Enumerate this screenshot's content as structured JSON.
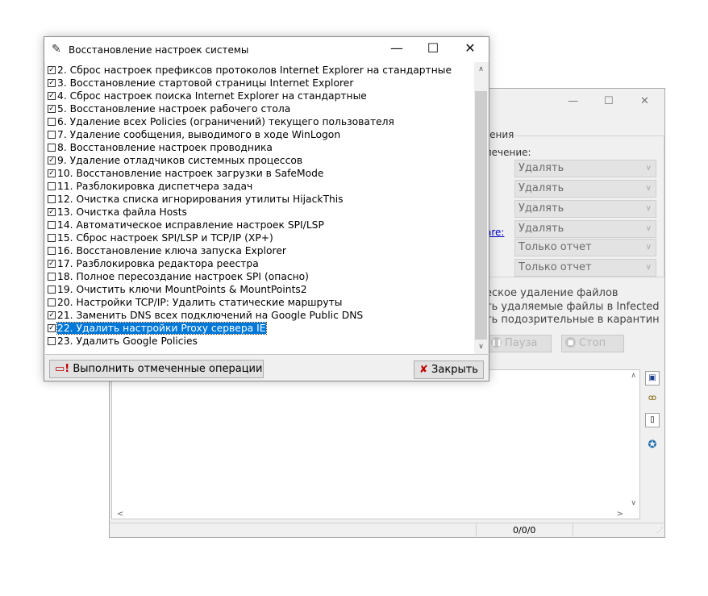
{
  "background_window": {
    "controls": {
      "minimize": "—",
      "maximize": "☐",
      "close": "✕"
    },
    "group_title": "чения",
    "treatment_label": "лечение:",
    "links": [
      "",
      ":",
      "are:"
    ],
    "dropdowns": [
      "Удалять",
      "Удалять",
      "Удалять",
      "Удалять",
      "Только отчет",
      "Только отчет"
    ],
    "options": [
      "еское удаление файлов",
      "ть удаляемые файлы в  Infected",
      "ть подозрительные в  карантин"
    ],
    "pause_button": "Пауза",
    "stop_button": "Стоп",
    "status_counter": "0/0/0"
  },
  "dialog": {
    "title": "Восстановление настроек системы",
    "controls": {
      "minimize": "—",
      "maximize": "☐",
      "close": "✕"
    },
    "items": [
      {
        "label": "2. Сброс настроек префиксов протоколов Internet Explorer на стандартные",
        "checked": true
      },
      {
        "label": "3. Восстановление стартовой страницы Internet Explorer",
        "checked": true
      },
      {
        "label": "4. Сброс настроек поиска Internet Explorer на стандартные",
        "checked": true
      },
      {
        "label": "5. Восстановление настроек рабочего стола",
        "checked": true
      },
      {
        "label": "6. Удаление всех Policies (ограничений) текущего пользователя",
        "checked": false
      },
      {
        "label": "7. Удаление сообщения, выводимого в ходе WinLogon",
        "checked": false
      },
      {
        "label": "8. Восстановление настроек проводника",
        "checked": false
      },
      {
        "label": "9. Удаление отладчиков системных процессов",
        "checked": true
      },
      {
        "label": "10. Восстановление настроек загрузки в SafeMode",
        "checked": true
      },
      {
        "label": "11. Разблокировка диспетчера задач",
        "checked": false
      },
      {
        "label": "12. Очистка списка игнорирования утилиты HijackThis",
        "checked": false
      },
      {
        "label": "13. Очистка файла Hosts",
        "checked": true
      },
      {
        "label": "14. Автоматическое исправление настроек SPI/LSP",
        "checked": false
      },
      {
        "label": "15. Сброс настроек SPI/LSP и TCP/IP (XP+)",
        "checked": false
      },
      {
        "label": "16. Восстановление ключа запуска Explorer",
        "checked": false
      },
      {
        "label": "17. Разблокировка редактора реестра",
        "checked": true
      },
      {
        "label": "18. Полное пересоздание настроек SPI (опасно)",
        "checked": false
      },
      {
        "label": "19. Очистить ключи MountPoints & MountPoints2",
        "checked": false
      },
      {
        "label": "20. Настройки TCP/IP: Удалить статические маршруты",
        "checked": false
      },
      {
        "label": "21. Заменить DNS всех подключений на Google Public DNS",
        "checked": true
      },
      {
        "label": "22. Удалить настройки Proxy сервера IE",
        "checked": true,
        "selected": true
      },
      {
        "label": "23. Удалить Google Policies",
        "checked": false
      }
    ],
    "execute_button": "Выполнить отмеченные операции",
    "close_button": "Закрыть",
    "colors": {
      "selection": "#0078d7",
      "close_x": "#c00000"
    }
  }
}
